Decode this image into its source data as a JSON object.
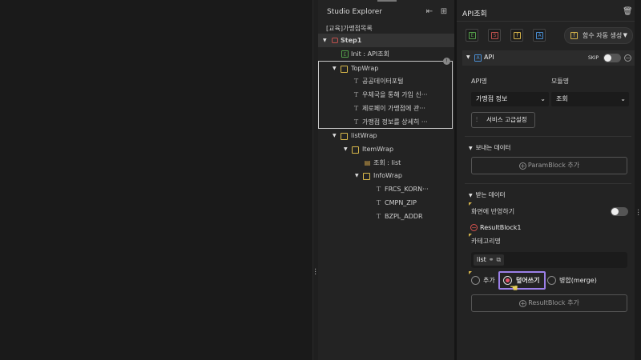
{
  "explorer": {
    "title": "Studio Explorer",
    "path": "[교육]가맹점목록",
    "tree": [
      {
        "label": "Step1",
        "kind": "step"
      },
      {
        "label": "Init : API조회",
        "kind": "api"
      },
      {
        "label": "TopWrap",
        "kind": "folder"
      },
      {
        "label": "공공데이터포털",
        "kind": "text"
      },
      {
        "label": "우체국을 통해 가입 신···",
        "kind": "text"
      },
      {
        "label": "제로페이 가맹점에 관···",
        "kind": "text"
      },
      {
        "label": "가맹점 정보를 상세히 ···",
        "kind": "text"
      },
      {
        "label": "listWrap",
        "kind": "folder"
      },
      {
        "label": "ItemWrap",
        "kind": "folder"
      },
      {
        "label": "조회 : list",
        "kind": "db"
      },
      {
        "label": "InfoWrap",
        "kind": "folder"
      },
      {
        "label": "FRCS_KORN···",
        "kind": "text"
      },
      {
        "label": "CMPN_ZIP",
        "kind": "text"
      },
      {
        "label": "BZPL_ADDR",
        "kind": "text"
      }
    ]
  },
  "props": {
    "title": "API조회",
    "generate_button": "함수 자동 생성",
    "api_section": {
      "label": "API",
      "skip_label": "SKIP"
    },
    "api_name_label": "API명",
    "module_name_label": "모듈명",
    "api_select_value": "가맹점 정보",
    "module_select_value": "조회",
    "service_button": "서비스 고급설정",
    "send_section": "보내는 데이터",
    "param_add": "ParamBlock 추가",
    "receive_section": "받는 데이터",
    "reflect_label": "화면에 반영하기",
    "result_block": "ResultBlock1",
    "category_label": "카테고리명",
    "list_chip": "list",
    "radio_options": [
      "추가",
      "덮어쓰기",
      "병합(merge)"
    ],
    "radio_selected": "덮어쓰기",
    "result_add": "ResultBlock 추가"
  },
  "colors": {
    "accent_purple": "#9b7fe8",
    "radio_on": "#e6506a",
    "folder": "#d8b84a",
    "api_blue": "#4a8fd4",
    "api_green": "#55a14b"
  }
}
